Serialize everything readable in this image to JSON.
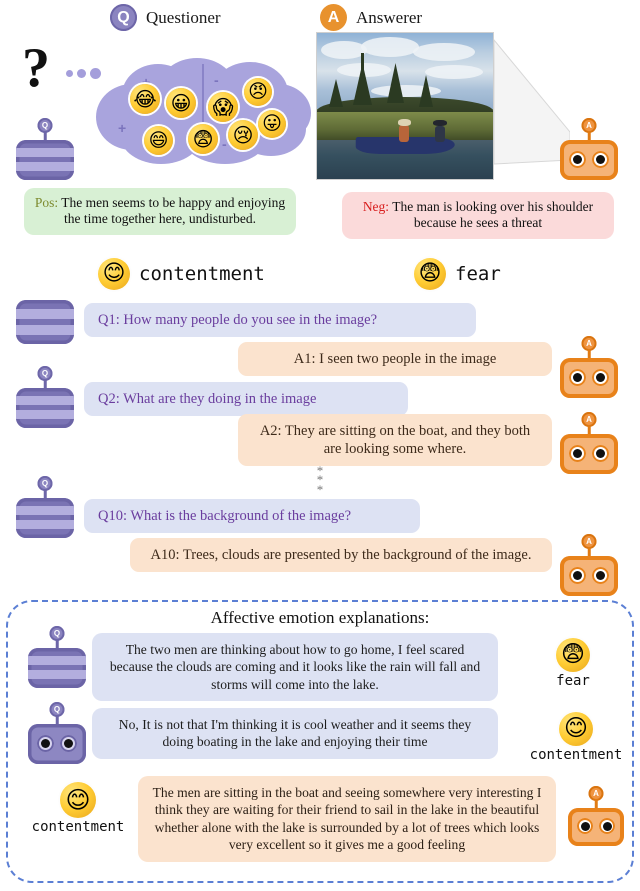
{
  "header": {
    "questioner": {
      "badge": "Q",
      "label": "Questioner"
    },
    "answerer": {
      "badge": "A",
      "label": "Answerer"
    }
  },
  "thought_cloud": {
    "question_mark": "?",
    "positive_signs": [
      "+",
      "+",
      "+",
      "+"
    ],
    "negative_signs": [
      "-",
      "-",
      "-",
      "-",
      "-"
    ],
    "emoji_names": [
      "laughing-face",
      "smiling-wide-eyes",
      "grinning-face",
      "surprised-face",
      "fear-face",
      "angry-face",
      "tongue-out-face",
      "sad-crying-face"
    ]
  },
  "image_panel": {
    "alt": "watercolor-painting-two-men-in-blue-canoe-on-lake"
  },
  "sentiment": {
    "positive": {
      "tag": "Pos:",
      "text": " The men seems to be happy and enjoying the time together here, undisturbed.",
      "color": "#d8f0d4"
    },
    "negative": {
      "tag": "Neg:",
      "text": " The man is looking over his shoulder because he sees a threat",
      "color": "#fbdada"
    }
  },
  "emotion_labels": {
    "left": {
      "name": "contentment",
      "emoji": "smiling-content-face"
    },
    "right": {
      "name": "fear",
      "emoji": "fearful-face"
    }
  },
  "dialogue": [
    {
      "role": "questioner",
      "text": "Q1: How many people do you see in the image?"
    },
    {
      "role": "answerer",
      "text": "A1: I seen two people in the image"
    },
    {
      "role": "questioner",
      "text": "Q2: What are they doing in the image"
    },
    {
      "role": "answerer",
      "text": "A2: They are sitting on the boat, and they both are looking some where."
    },
    {
      "role": "questioner",
      "text": "Q10: What is the background of the image?"
    },
    {
      "role": "answerer",
      "text": "A10: Trees, clouds are presented by the background of the image."
    }
  ],
  "ellipsis": "*\n*\n*",
  "affective": {
    "title": "Affective emotion explanations:",
    "entries": [
      {
        "role": "questioner",
        "text": "The two men are thinking about how to go home, I feel scared because the clouds are coming and it looks like the rain will fall and storms will come into the lake.",
        "emotion": "fear",
        "emoji": "fearful-face"
      },
      {
        "role": "questioner",
        "text": "No, It is not that I'm thinking it is cool weather and it seems they doing boating in the lake and enjoying their time",
        "emotion": "contentment",
        "emoji": "smiling-content-face"
      },
      {
        "role": "answerer",
        "text": "The men are sitting in the boat and seeing somewhere very interesting I think they are waiting for their friend to sail in the lake in the beautiful whether alone with the lake is surrounded by a lot of trees which looks very excellent so it gives me a good feeling",
        "emotion": "contentment",
        "emoji": "smiling-content-face"
      }
    ]
  },
  "colors": {
    "questioner_purple": "#7a73b4",
    "answerer_orange": "#e8821a",
    "question_bubble": "#dde2f3",
    "answer_bubble": "#fbe3ce",
    "panel_border": "#5b7fd4"
  }
}
